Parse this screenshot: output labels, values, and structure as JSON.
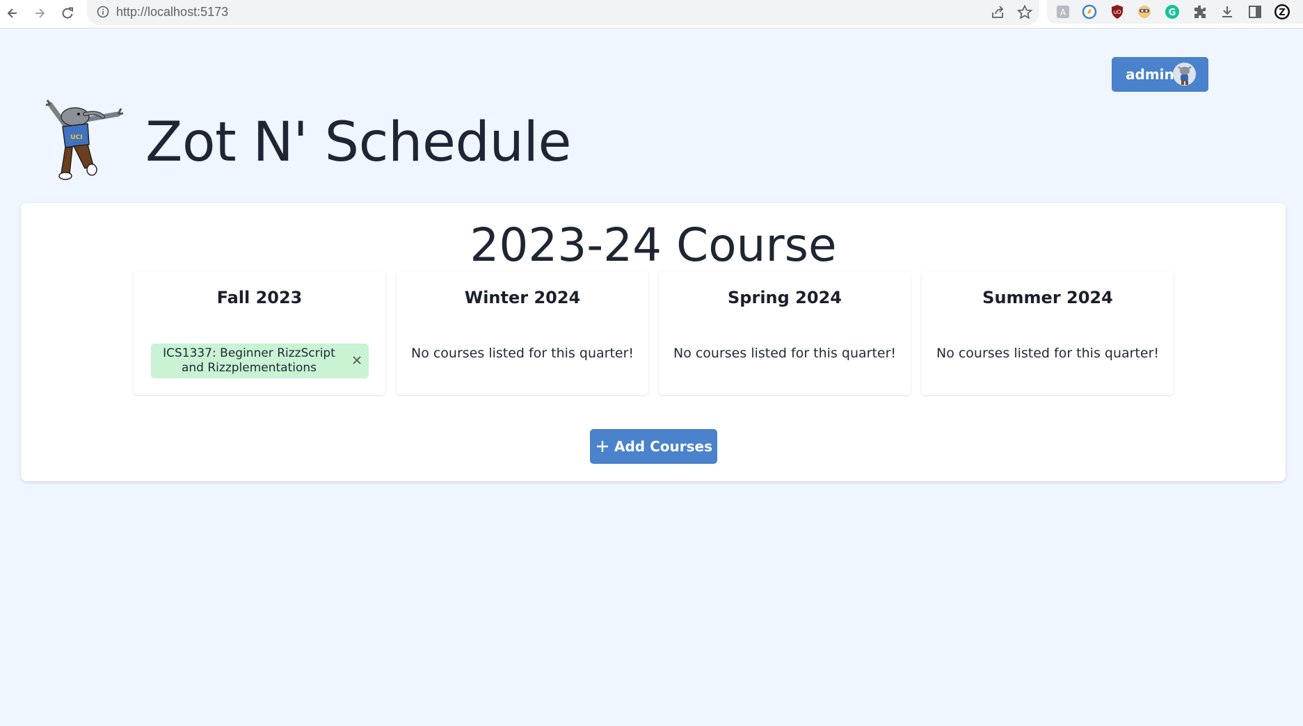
{
  "browser": {
    "url": "http://localhost:5173",
    "icons": [
      "back-arrow-icon",
      "forward-arrow-icon",
      "reload-icon",
      "site-info-icon",
      "share-icon",
      "bookmark-star-icon",
      "extensions-puzzle-icon",
      "download-icon",
      "side-panel-icon",
      "profile-icon"
    ]
  },
  "header": {
    "user_button_label": "admin",
    "app_title": "Zot N' Schedule"
  },
  "main": {
    "year_title": "2023-24 Course",
    "quarters": [
      {
        "title": "Fall 2023",
        "courses": [
          "ICS1337: Beginner RizzScript and Rizzplementations"
        ],
        "empty_text": ""
      },
      {
        "title": "Winter 2024",
        "courses": [],
        "empty_text": "No courses listed for this quarter!"
      },
      {
        "title": "Spring 2024",
        "courses": [],
        "empty_text": "No courses listed for this quarter!"
      },
      {
        "title": "Summer 2024",
        "courses": [],
        "empty_text": "No courses listed for this quarter!"
      }
    ],
    "add_button_label": "Add Courses"
  },
  "colors": {
    "page_background": "#eff6ff",
    "primary_button": "#4a82cc",
    "course_chip": "#c9f3d3"
  }
}
